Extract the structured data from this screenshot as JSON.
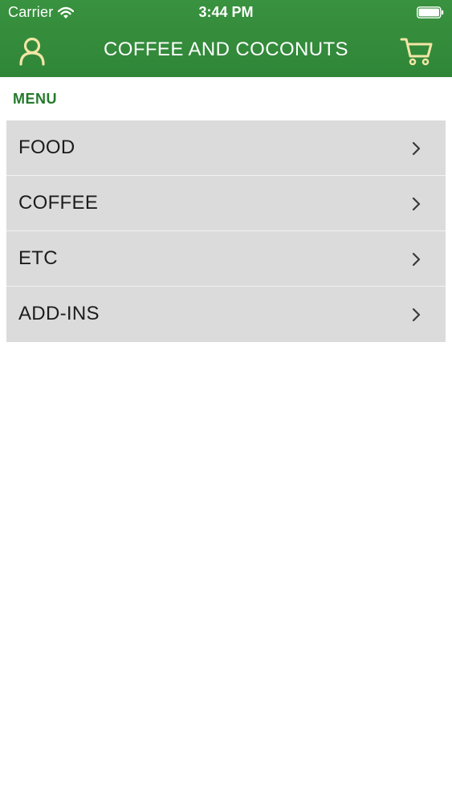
{
  "status_bar": {
    "carrier": "Carrier",
    "time": "3:44 PM",
    "icons": [
      "wifi-icon",
      "battery-icon"
    ]
  },
  "nav": {
    "title": "COFFEE AND COCONUTS",
    "left_icon": "profile-icon",
    "right_icon": "cart-icon"
  },
  "menu": {
    "header": "MENU",
    "items": [
      {
        "label": "FOOD"
      },
      {
        "label": "COFFEE"
      },
      {
        "label": "ETC"
      },
      {
        "label": "ADD-INS"
      }
    ],
    "chevron_icon": "chevron-right-icon"
  },
  "colors": {
    "nav_green": "#2f8638",
    "header_green": "#237a2b",
    "icon_cream": "#f3e6a6",
    "row_gray": "#dcdbdc"
  }
}
